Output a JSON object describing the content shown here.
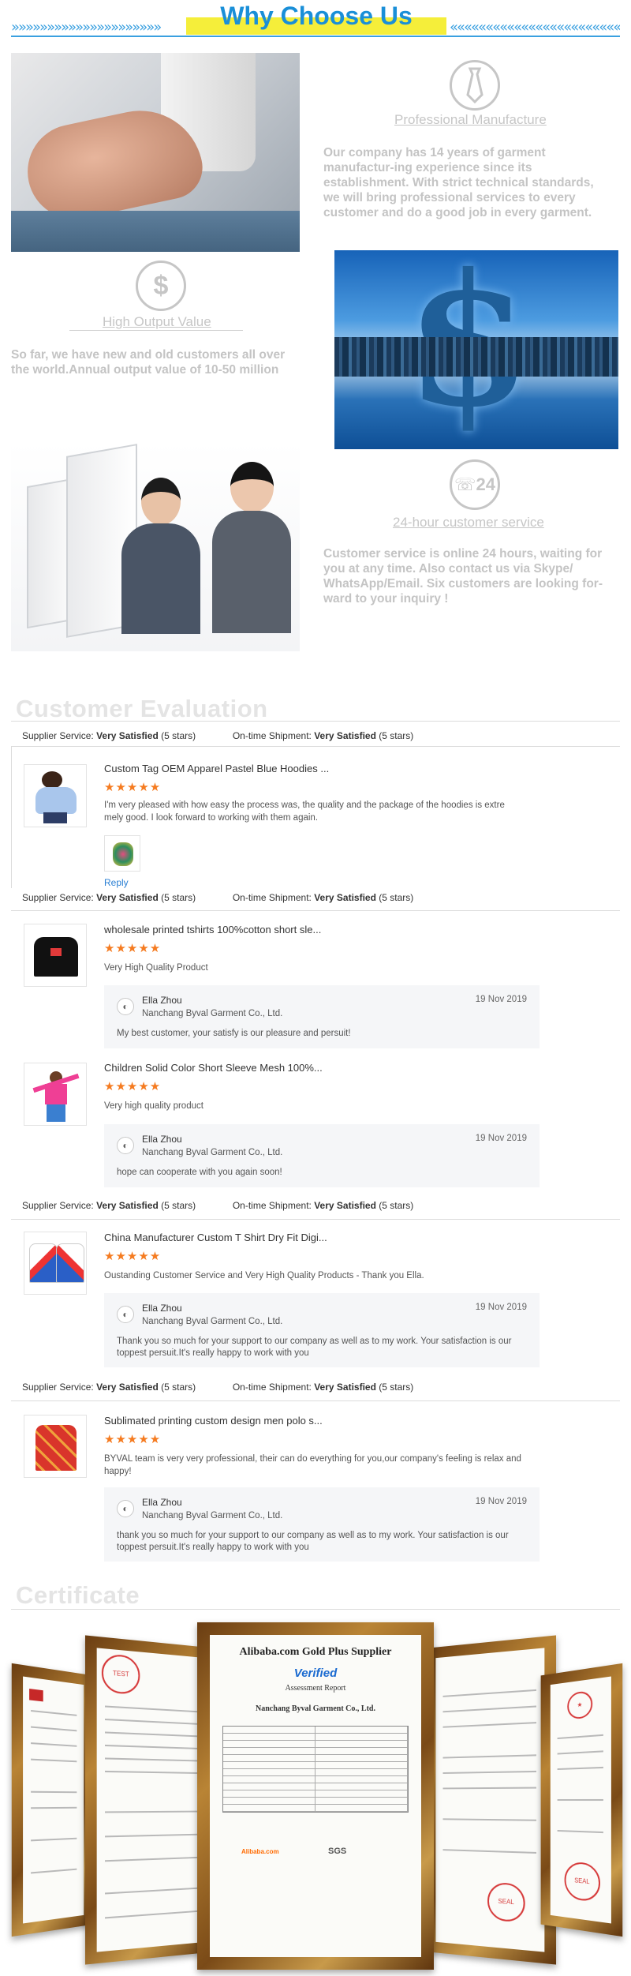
{
  "header": {
    "title": "Why Choose Us",
    "left_chevrons": "»»»»»»»»»»»»»»»»»»»»»",
    "right_chevrons": "«««««««««««««««««««««««««"
  },
  "features": [
    {
      "icon": "tie-icon",
      "title": "Professional Manufacture",
      "text": "Our company has 14 years of garment manufactur-ing experience since its establishment. With strict technical standards, we will bring professional services to every customer and do a good job in every garment."
    },
    {
      "icon": "dollar-chart-icon",
      "title": "High Output Value",
      "text": "So far, we have new and old customers all over the world.Annual output value of 10-50 million"
    },
    {
      "icon": "phone-24-icon",
      "title": "24-hour customer service",
      "text": "Customer service is online 24 hours, waiting for you at any time. Also contact us via Skype/ WhatsApp/Email. Six customers are looking for-ward to your inquiry !"
    }
  ],
  "evaluation": {
    "title": "Customer Evaluation",
    "summary_label1": "Supplier Service:",
    "summary_value1": "Very Satisfied",
    "summary_stars1": "(5 stars)",
    "summary_label2": "On-time Shipment:",
    "summary_value2": "Very Satisfied",
    "summary_stars2": "(5 stars)",
    "stars": "★★★★★",
    "reply_label": "Reply",
    "reviews": [
      {
        "product": "Custom Tag OEM Apparel Pastel Blue Hoodies ...",
        "text": "I'm very pleased with how easy the process was, the quality and the package of the hoodies is extre mely good. I look forward to working with them again."
      },
      {
        "product": "wholesale printed tshirts 100%cotton short sle...",
        "text": "Very High Quality Product",
        "reply": {
          "name": "Ella Zhou",
          "company": "Nanchang Byval Garment Co., Ltd.",
          "date": "19 Nov 2019",
          "message": "My best customer, your satisfy is our pleasure and persuit!"
        }
      },
      {
        "product": "Children Solid Color Short Sleeve Mesh 100%...",
        "text": "Very high quality product",
        "reply": {
          "name": "Ella Zhou",
          "company": "Nanchang Byval Garment Co., Ltd.",
          "date": "19 Nov 2019",
          "message": "hope can cooperate with you again soon!"
        }
      },
      {
        "product": "China Manufacturer Custom T Shirt Dry Fit Digi...",
        "text": "Oustanding Customer Service and Very High Quality Products - Thank you Ella.",
        "reply": {
          "name": "Ella Zhou",
          "company": "Nanchang Byval Garment Co., Ltd.",
          "date": "19 Nov 2019",
          "message": "Thank you so much for your support to our company as well as to my work. Your satisfaction is our toppest persuit.It's really happy to work with you"
        }
      },
      {
        "product": "Sublimated printing custom design men polo s...",
        "text": "BYVAL team is very very professional, their can do everything for you,our company's feeling is relax and happy!",
        "reply": {
          "name": "Ella Zhou",
          "company": "Nanchang Byval Garment Co., Ltd.",
          "date": "19 Nov 2019",
          "message": " thank you so much for your support to our company as well as to my work. Your satisfaction is our toppest persuit.It's really happy to work with you"
        }
      }
    ]
  },
  "certificate": {
    "title": "Certificate",
    "main": {
      "title": "Alibaba.com Gold Plus Supplier",
      "verified": "Verified",
      "subtitle": "Assessment Report",
      "company": "Nanchang Byval Garment Co., Ltd.",
      "sgs": "SGS",
      "alibaba": "Alibaba.com"
    }
  }
}
